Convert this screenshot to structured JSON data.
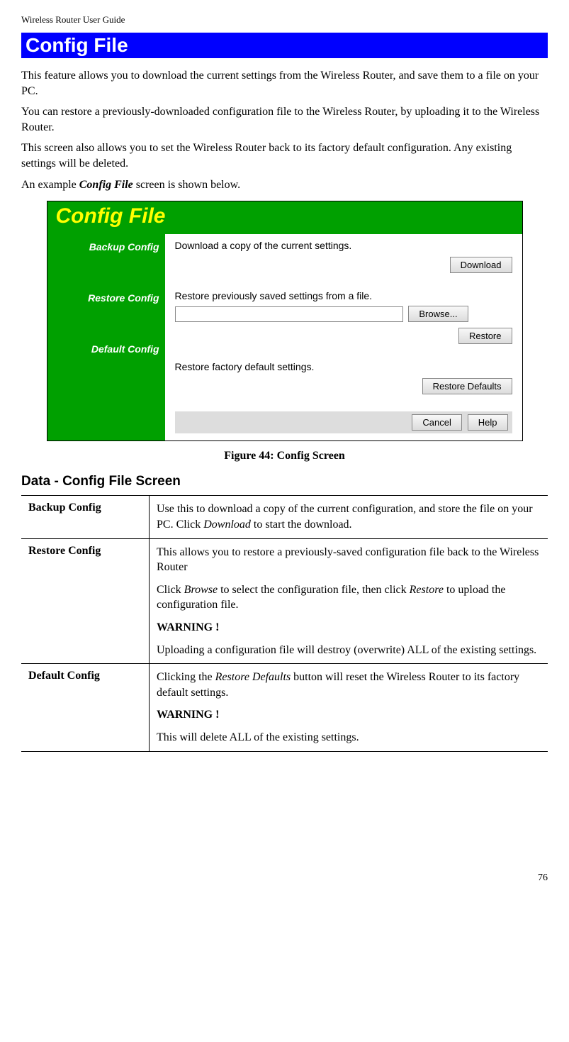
{
  "doc_header": "Wireless Router User Guide",
  "section_title": "Config File",
  "intro": {
    "p1": "This feature allows you to download the current settings from the Wireless Router, and save them to a file on your PC.",
    "p2": "You can restore a previously-downloaded configuration file to the Wireless Router, by uploading it to the Wireless Router.",
    "p3": "This screen also allows you to set the Wireless Router back to its factory default configuration. Any existing settings will be deleted.",
    "p4_pre": "An example ",
    "p4_em": "Config File",
    "p4_post": " screen is shown below."
  },
  "figure": {
    "title": "Config File",
    "sidebar": {
      "backup": "Backup Config",
      "restore": "Restore Config",
      "default": "Default Config"
    },
    "backup_text": "Download a copy of the current settings.",
    "download_btn": "Download",
    "restore_text": "Restore previously saved settings from a file.",
    "browse_btn": "Browse...",
    "restore_btn": "Restore",
    "default_text": "Restore factory default settings.",
    "restore_defaults_btn": "Restore Defaults",
    "cancel_btn": "Cancel",
    "help_btn": "Help",
    "caption": "Figure 44: Config Screen"
  },
  "data_heading": "Data - Config File Screen",
  "table": {
    "r1_label": "Backup Config",
    "r1_p1_pre": "Use this to download a copy of the current configuration, and store the file on your PC. Click ",
    "r1_p1_em": "Download",
    "r1_p1_post": " to start the download.",
    "r2_label": "Restore Config",
    "r2_p1": "This allows you to restore a previously-saved configuration file back to the Wireless Router",
    "r2_p2_pre": "Click ",
    "r2_p2_em1": "Browse",
    "r2_p2_mid": " to select the configuration file, then click ",
    "r2_p2_em2": "Restore",
    "r2_p2_post": " to upload the configuration file.",
    "r2_warn": "WARNING !",
    "r2_p3": "Uploading a configuration file will destroy (overwrite) ALL of the existing settings.",
    "r3_label": "Default Config",
    "r3_p1_pre": "Clicking the ",
    "r3_p1_em": "Restore Defaults",
    "r3_p1_post": " button will reset the Wireless Router to its factory default settings.",
    "r3_warn": "WARNING !",
    "r3_p2": "This will delete ALL of the existing settings."
  },
  "page_number": "76"
}
